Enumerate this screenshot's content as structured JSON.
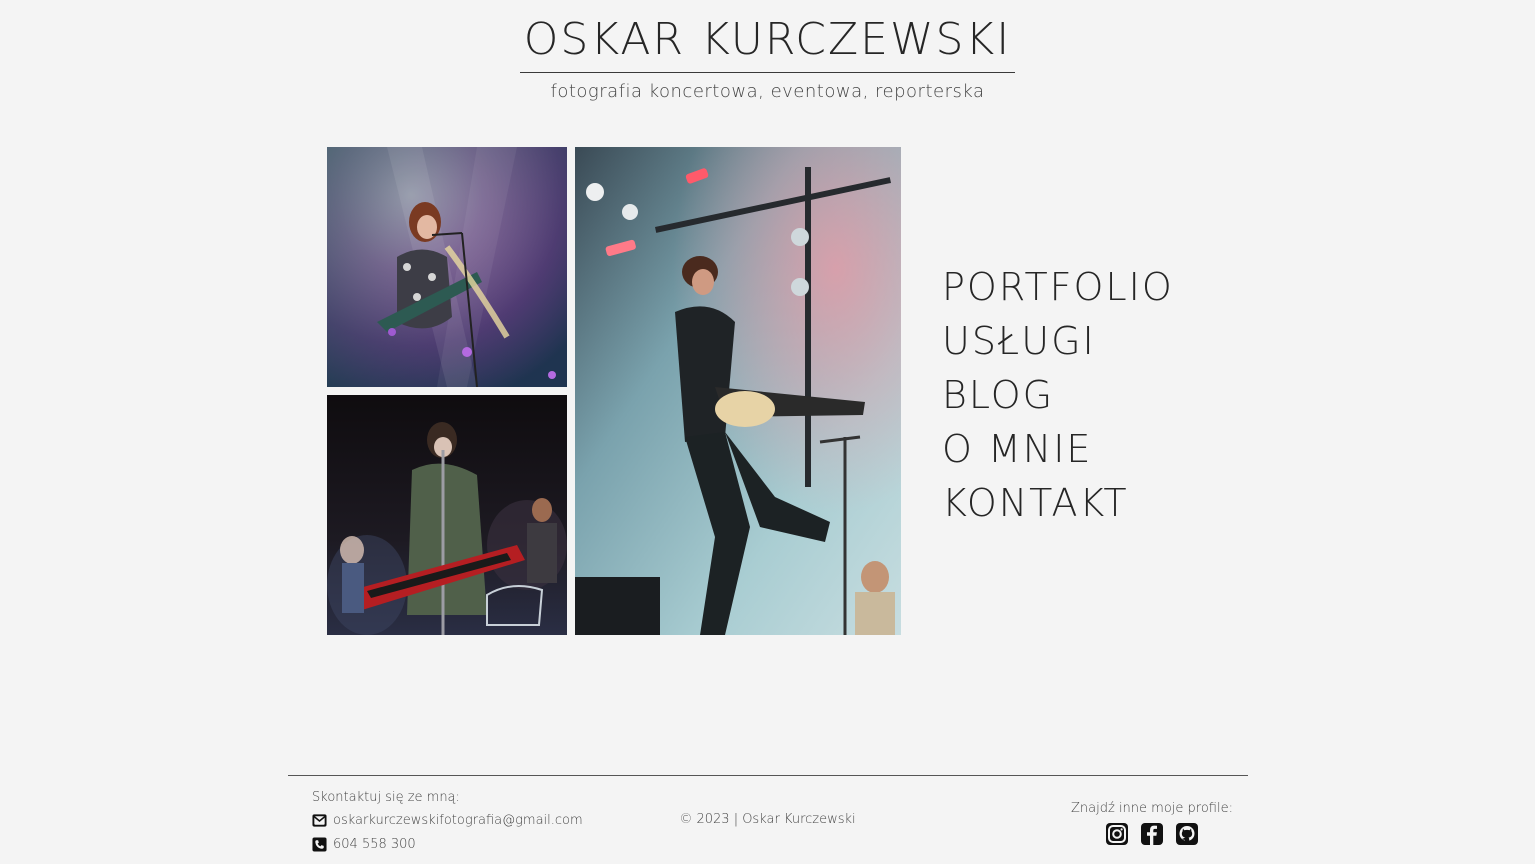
{
  "header": {
    "title": "OSKAR KURCZEWSKI",
    "subtitle": "fotografia koncertowa, eventowa, reporterska"
  },
  "nav": {
    "items": [
      "PORTFOLIO",
      "USŁUGI",
      "BLOG",
      "O MNIE",
      "KONTAKT"
    ]
  },
  "gallery": {
    "photos": [
      "concert-photo-guitarist-woman",
      "concert-photo-singer-keytar",
      "concert-photo-guitarist-jumping"
    ]
  },
  "footer": {
    "contact_heading": "Skontaktuj się ze mną:",
    "email": "oskarkurczewskifotografia@gmail.com",
    "phone": "604 558 300",
    "copyright": "© 2023 | Oskar Kurczewski",
    "profiles_heading": "Znajdź inne moje profile:",
    "socials": [
      "instagram-icon",
      "facebook-icon",
      "github-icon"
    ]
  },
  "colors": {
    "background": "#f4f4f4",
    "text": "#262626"
  }
}
